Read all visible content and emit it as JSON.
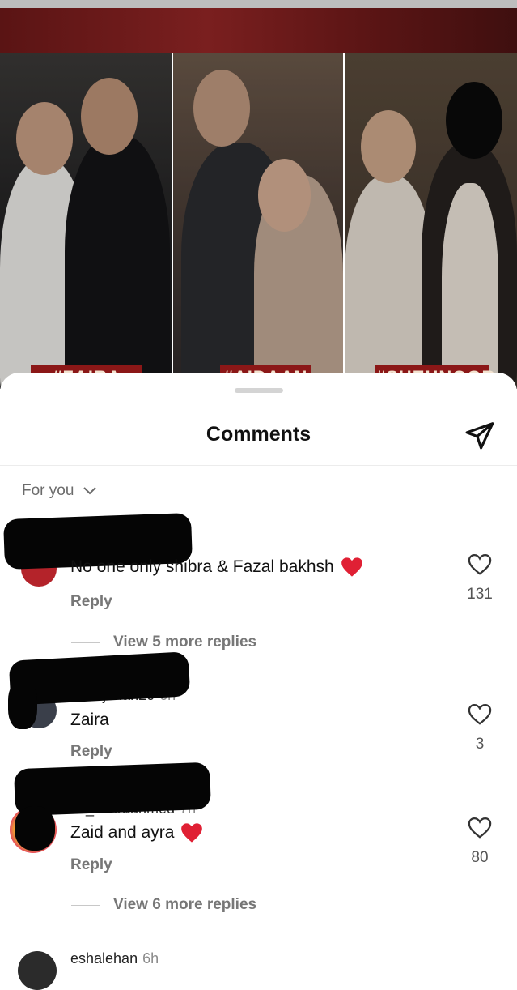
{
  "post": {
    "tags": [
      "#ZAIRA",
      "#AIDAAN",
      "#SHEHNOOR"
    ]
  },
  "sheet": {
    "title": "Comments",
    "sort_label": "For you"
  },
  "comments": [
    {
      "username": "",
      "time": "",
      "text": "No one only shibra &  Fazal bakhsh",
      "emoji": "red-heart",
      "reply_label": "Reply",
      "likes": "131",
      "more_replies": "View 5 more replies"
    },
    {
      "username": "eanajahan20",
      "time": "6h",
      "text": "Zaira",
      "emoji": "",
      "reply_label": "Reply",
      "likes": "3",
      "more_replies": ""
    },
    {
      "username": "im_zahraahmed",
      "time": "7h",
      "text": "Zaid and ayra",
      "emoji": "red-heart",
      "reply_label": "Reply",
      "likes": "80",
      "more_replies": "View 6 more replies"
    },
    {
      "username": "eshalehan",
      "time": "6h"
    }
  ],
  "colors": {
    "tag_bg": "#8b1717",
    "heart_red": "#e02034",
    "muted_text": "#777777"
  },
  "icons": {
    "share": "paper-plane-icon",
    "like": "heart-outline-icon",
    "sort": "chevron-down-icon"
  }
}
